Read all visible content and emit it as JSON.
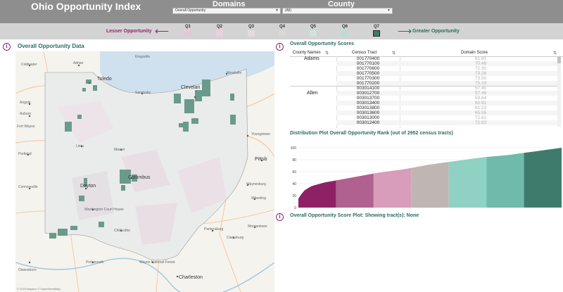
{
  "app_title": "Ohio Opportunity Index",
  "filters": {
    "domains": {
      "label": "Domains",
      "value": "Overall Opportunity"
    },
    "county": {
      "label": "County",
      "value": "(All)"
    }
  },
  "legend": {
    "lesser": "Lesser Opportunity",
    "greater": "Greater Opportunity",
    "quintiles": [
      {
        "label": "Q1",
        "color": "#e3c8d6"
      },
      {
        "label": "Q2",
        "color": "#e7d2dd"
      },
      {
        "label": "Q3",
        "color": "#e5dade"
      },
      {
        "label": "Q4",
        "color": "#dad7d6"
      },
      {
        "label": "Q5",
        "color": "#cfe2dc"
      },
      {
        "label": "Q6",
        "color": "#bcdcd2"
      },
      {
        "label": "Q7",
        "color": "#3f7b6c"
      }
    ],
    "lesser_color": "#8b2a6b",
    "greater_color": "#2e6b5e"
  },
  "map_panel": {
    "title": "Overall Opportunity Data",
    "cities": [
      "Kingsville",
      "Coldwater",
      "Adrian",
      "Toledo",
      "Sandusky",
      "Clevelan",
      "Meadville",
      "Angola",
      "Auburn",
      "Fort Wayne",
      "Youngstown",
      "Lima",
      "Marion",
      "Portland",
      "Dayton",
      "Columbus",
      "Pittsb",
      "Connersville",
      "Washington Court House",
      "Chillicothe",
      "Wheeling",
      "Waynesburg",
      "Morgantown",
      "Clarksburg",
      "Parkersburg",
      "Owensboro",
      "Portsmouth",
      "Charleston",
      "Wayne National Forest"
    ],
    "attribution": "© 2023 Mapbox © OpenStreetMap"
  },
  "scores_panel": {
    "title": "Overall Opportunity Scores",
    "columns": [
      "County Names",
      "Census Tract",
      "Domain Score"
    ],
    "rows": [
      {
        "county": "Adams",
        "tract": "001770400",
        "score": "61.91"
      },
      {
        "county": "",
        "tract": "001770100",
        "score": "70.49"
      },
      {
        "county": "",
        "tract": "001770600",
        "score": "72.30"
      },
      {
        "county": "",
        "tract": "001770500",
        "score": "73.28"
      },
      {
        "county": "",
        "tract": "001770300",
        "score": "73.50"
      },
      {
        "county": "",
        "tract": "001770200",
        "score": "75.33"
      },
      {
        "county": "Allen",
        "tract": "003014100",
        "score": "57.45"
      },
      {
        "county": "",
        "tract": "003012700",
        "score": "57.46"
      },
      {
        "county": "",
        "tract": "003013700",
        "score": "59.84"
      },
      {
        "county": "",
        "tract": "003013400",
        "score": "60.91"
      },
      {
        "county": "",
        "tract": "003013800",
        "score": "61.23"
      },
      {
        "county": "",
        "tract": "003013600",
        "score": "65.56"
      },
      {
        "county": "",
        "tract": "003013000",
        "score": "72.81"
      },
      {
        "county": "",
        "tract": "003012400",
        "score": "72.83"
      }
    ]
  },
  "distribution": {
    "title": "Distribution Plot Overall Opportunity Rank (out of 2952 census tracts)",
    "y_ticks": [
      "100",
      "80",
      "60",
      "40",
      "20",
      "0"
    ]
  },
  "score_plot": {
    "title": "Overall Opportunity Score Plot: Showing tract(s): None"
  },
  "chart_data": {
    "type": "area",
    "title": "Distribution Plot Overall Opportunity Rank (out of 2952 census tracts)",
    "ylim": [
      0,
      100
    ],
    "x": [
      0,
      0.02,
      0.05,
      0.1,
      0.15,
      0.2,
      0.3,
      0.4,
      0.5,
      0.6,
      0.7,
      0.8,
      0.9,
      1.0
    ],
    "y": [
      15,
      28,
      36,
      42,
      46,
      50,
      58,
      64,
      72,
      78,
      84,
      88,
      94,
      100
    ],
    "bands": [
      {
        "label": "Q1",
        "color": "#8e2166"
      },
      {
        "label": "Q2",
        "color": "#b0618f"
      },
      {
        "label": "Q3",
        "color": "#d79db9"
      },
      {
        "label": "Q4",
        "color": "#bfb5b3"
      },
      {
        "label": "Q5",
        "color": "#8fd1c2"
      },
      {
        "label": "Q6",
        "color": "#6fbaa8"
      },
      {
        "label": "Q7",
        "color": "#3f7b6c"
      }
    ]
  }
}
